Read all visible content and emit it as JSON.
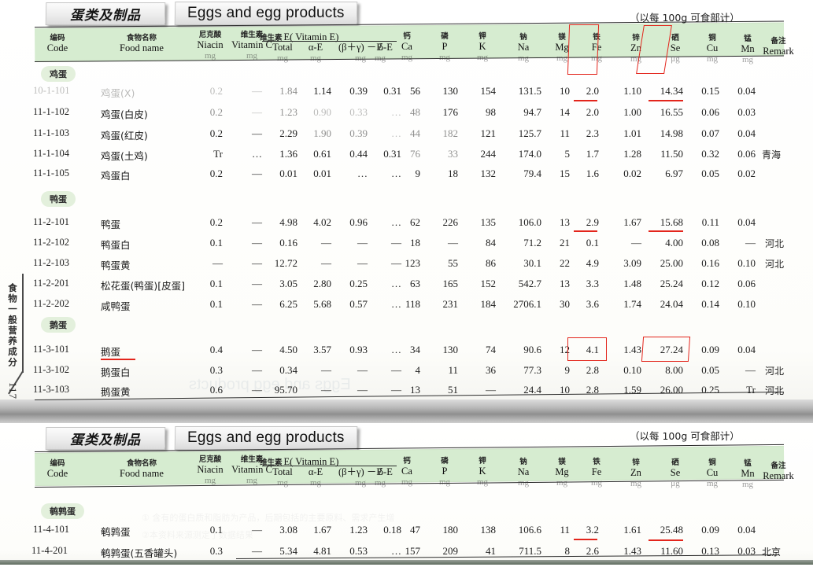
{
  "book": {
    "margin_vertical_text": "食物一般营养成分",
    "page_number": "117"
  },
  "pages": [
    {
      "id": "top",
      "title_cn": "蛋类及制品",
      "title_en": "Eggs and egg products",
      "per_100g_note": "（以每 100g 可食部计）",
      "columns": [
        {
          "cn": "编码",
          "en": "Code",
          "unit": ""
        },
        {
          "cn": "食物名称",
          "en": "Food name",
          "unit": ""
        },
        {
          "cn": "尼克酸",
          "en": "Niacin",
          "unit": "mg"
        },
        {
          "cn": "维生素",
          "en": "Vitamin C",
          "unit": "mg",
          "cn_suffix": "C"
        },
        {
          "cn": "",
          "en": "Total",
          "unit": "mg"
        },
        {
          "cn": "",
          "en": "α-E",
          "unit": "mg"
        },
        {
          "cn": "",
          "en": "(β＋γ) －E",
          "unit": "mg"
        },
        {
          "cn": "",
          "en": "δ-E",
          "unit": "mg"
        },
        {
          "cn": "钙",
          "en": "Ca",
          "unit": "mg"
        },
        {
          "cn": "磷",
          "en": "P",
          "unit": "mg"
        },
        {
          "cn": "钾",
          "en": "K",
          "unit": "mg"
        },
        {
          "cn": "钠",
          "en": "Na",
          "unit": "mg"
        },
        {
          "cn": "镁",
          "en": "Mg",
          "unit": "mg"
        },
        {
          "cn": "铁",
          "en": "Fe",
          "unit": "mg"
        },
        {
          "cn": "锌",
          "en": "Zn",
          "unit": "mg"
        },
        {
          "cn": "硒",
          "en": "Se",
          "unit": "μg"
        },
        {
          "cn": "铜",
          "en": "Cu",
          "unit": "mg"
        },
        {
          "cn": "锰",
          "en": "Mn",
          "unit": "mg"
        },
        {
          "cn": "备注",
          "en": "Remark",
          "unit": ""
        }
      ],
      "vitamin_e_group": {
        "cn": "维生素",
        "en": "E( Vitamin E)"
      },
      "sections": [
        {
          "label": "鸡蛋",
          "rows": [
            {
              "code": "10-1-101",
              "name": "鸡蛋(X)",
              "niacin": "0.2",
              "vitc": "—",
              "total": "1.84",
              "ae": "1.14",
              "bge": "0.39",
              "de": "0.31",
              "ca": "56",
              "p": "130",
              "k": "154",
              "na": "131.5",
              "mg": "10",
              "fe": "2.0",
              "zn": "1.10",
              "se": "14.34",
              "cu": "0.15",
              "mn": "0.04",
              "remark": ""
            },
            {
              "code": "11-1-102",
              "name": "鸡蛋(白皮)",
              "niacin": "0.2",
              "vitc": "—",
              "total": "1.23",
              "ae": "0.90",
              "bge": "0.33",
              "de": "…",
              "ca": "48",
              "p": "176",
              "k": "98",
              "na": "94.7",
              "mg": "14",
              "fe": "2.0",
              "zn": "1.00",
              "se": "16.55",
              "cu": "0.06",
              "mn": "0.03",
              "remark": ""
            },
            {
              "code": "11-1-103",
              "name": "鸡蛋(红皮)",
              "niacin": "0.2",
              "vitc": "—",
              "total": "2.29",
              "ae": "1.90",
              "bge": "0.39",
              "de": "…",
              "ca": "44",
              "p": "182",
              "k": "121",
              "na": "125.7",
              "mg": "11",
              "fe": "2.3",
              "zn": "1.01",
              "se": "14.98",
              "cu": "0.07",
              "mn": "0.04",
              "remark": ""
            },
            {
              "code": "11-1-104",
              "name": "鸡蛋(土鸡)",
              "niacin": "Tr",
              "vitc": "…",
              "total": "1.36",
              "ae": "0.61",
              "bge": "0.44",
              "de": "0.31",
              "ca": "76",
              "p": "33",
              "k": "244",
              "na": "174.0",
              "mg": "5",
              "fe": "1.7",
              "zn": "1.28",
              "se": "11.50",
              "cu": "0.32",
              "mn": "0.06",
              "remark": "青海"
            },
            {
              "code": "11-1-105",
              "name": "鸡蛋白",
              "niacin": "0.2",
              "vitc": "—",
              "total": "0.01",
              "ae": "0.01",
              "bge": "…",
              "de": "…",
              "ca": "9",
              "p": "18",
              "k": "132",
              "na": "79.4",
              "mg": "15",
              "fe": "1.6",
              "zn": "0.02",
              "se": "6.97",
              "cu": "0.05",
              "mn": "0.02",
              "remark": ""
            }
          ]
        },
        {
          "label": "鸭蛋",
          "rows": [
            {
              "code": "11-2-101",
              "name": "鸭蛋",
              "niacin": "0.2",
              "vitc": "—",
              "total": "4.98",
              "ae": "4.02",
              "bge": "0.96",
              "de": "…",
              "ca": "62",
              "p": "226",
              "k": "135",
              "na": "106.0",
              "mg": "13",
              "fe": "2.9",
              "zn": "1.67",
              "se": "15.68",
              "cu": "0.11",
              "mn": "0.04",
              "remark": ""
            },
            {
              "code": "11-2-102",
              "name": "鸭蛋白",
              "niacin": "0.1",
              "vitc": "—",
              "total": "0.16",
              "ae": "—",
              "bge": "—",
              "de": "—",
              "ca": "18",
              "p": "—",
              "k": "84",
              "na": "71.2",
              "mg": "21",
              "fe": "0.1",
              "zn": "—",
              "se": "4.00",
              "cu": "0.08",
              "mn": "—",
              "remark": "河北"
            },
            {
              "code": "11-2-103",
              "name": "鸭蛋黄",
              "niacin": "—",
              "vitc": "—",
              "total": "12.72",
              "ae": "—",
              "bge": "—",
              "de": "—",
              "ca": "123",
              "p": "55",
              "k": "86",
              "na": "30.1",
              "mg": "22",
              "fe": "4.9",
              "zn": "3.09",
              "se": "25.00",
              "cu": "0.16",
              "mn": "0.10",
              "remark": "河北"
            },
            {
              "code": "11-2-201",
              "name": "松花蛋(鸭蛋)[皮蛋]",
              "niacin": "0.1",
              "vitc": "—",
              "total": "3.05",
              "ae": "2.80",
              "bge": "0.25",
              "de": "…",
              "ca": "63",
              "p": "165",
              "k": "152",
              "na": "542.7",
              "mg": "13",
              "fe": "3.3",
              "zn": "1.48",
              "se": "25.24",
              "cu": "0.12",
              "mn": "0.06",
              "remark": ""
            },
            {
              "code": "11-2-202",
              "name": "咸鸭蛋",
              "niacin": "0.1",
              "vitc": "—",
              "total": "6.25",
              "ae": "5.68",
              "bge": "0.57",
              "de": "…",
              "ca": "118",
              "p": "231",
              "k": "184",
              "na": "2706.1",
              "mg": "30",
              "fe": "3.6",
              "zn": "1.74",
              "se": "24.04",
              "cu": "0.14",
              "mn": "0.10",
              "remark": ""
            }
          ]
        },
        {
          "label": "鹅蛋",
          "rows": [
            {
              "code": "11-3-101",
              "name": "鹅蛋",
              "niacin": "0.4",
              "vitc": "—",
              "total": "4.50",
              "ae": "3.57",
              "bge": "0.93",
              "de": "…",
              "ca": "34",
              "p": "130",
              "k": "74",
              "na": "90.6",
              "mg": "12",
              "fe": "4.1",
              "zn": "1.43",
              "se": "27.24",
              "cu": "0.09",
              "mn": "0.04",
              "remark": ""
            },
            {
              "code": "11-3-102",
              "name": "鹅蛋白",
              "niacin": "0.3",
              "vitc": "—",
              "total": "0.34",
              "ae": "—",
              "bge": "—",
              "de": "—",
              "ca": "4",
              "p": "11",
              "k": "36",
              "na": "77.3",
              "mg": "9",
              "fe": "2.8",
              "zn": "0.10",
              "se": "8.00",
              "cu": "0.05",
              "mn": "—",
              "remark": "河北"
            },
            {
              "code": "11-3-103",
              "name": "鹅蛋黄",
              "niacin": "0.6",
              "vitc": "—",
              "total": "95.70",
              "ae": "—",
              "bge": "—",
              "de": "—",
              "ca": "13",
              "p": "51",
              "k": "—",
              "na": "24.4",
              "mg": "10",
              "fe": "2.8",
              "zn": "1.59",
              "se": "26.00",
              "cu": "0.25",
              "mn": "Tr",
              "remark": "河北"
            }
          ]
        }
      ]
    },
    {
      "id": "bottom",
      "title_cn": "蛋类及制品",
      "title_en": "Eggs and egg products",
      "per_100g_note": "（以每 100g 可食部计）",
      "sections": [
        {
          "label": "鹌鹑蛋",
          "rows": [
            {
              "code": "11-4-101",
              "name": "鹌鹑蛋",
              "niacin": "0.1",
              "vitc": "—",
              "total": "3.08",
              "ae": "1.67",
              "bge": "1.23",
              "de": "0.18",
              "ca": "47",
              "p": "180",
              "k": "138",
              "na": "106.6",
              "mg": "11",
              "fe": "3.2",
              "zn": "1.61",
              "se": "25.48",
              "cu": "0.09",
              "mn": "0.04",
              "remark": ""
            },
            {
              "code": "11-4-201",
              "name": "鹌鹑蛋(五香罐头)",
              "niacin": "0.3",
              "vitc": "—",
              "total": "5.34",
              "ae": "4.81",
              "bge": "0.53",
              "de": "…",
              "ca": "157",
              "p": "209",
              "k": "41",
              "na": "711.5",
              "mg": "8",
              "fe": "2.6",
              "zn": "1.43",
              "se": "11.60",
              "cu": "0.13",
              "mn": "0.03",
              "remark": "北京"
            }
          ]
        }
      ]
    }
  ],
  "annotations": {
    "accent_color": "#e3251c",
    "underlined_values": [
      {
        "page": "top",
        "row": "10-1-101",
        "column": "fe",
        "value": "2.0"
      },
      {
        "page": "top",
        "row": "10-1-101",
        "column": "se",
        "value": "14.34"
      },
      {
        "page": "top",
        "row": "11-2-101",
        "column": "fe",
        "value": "2.9"
      },
      {
        "page": "top",
        "row": "11-2-101",
        "column": "se",
        "value": "15.68"
      },
      {
        "page": "top",
        "row": "11-3-101",
        "column": "name",
        "value": "鹅蛋"
      },
      {
        "page": "bottom",
        "row": "11-4-101",
        "column": "fe",
        "value": "3.2"
      },
      {
        "page": "bottom",
        "row": "11-4-101",
        "column": "se",
        "value": "25.48"
      }
    ],
    "boxed_values": [
      {
        "page": "top",
        "target": "header-fe",
        "value": "Fe"
      },
      {
        "page": "top",
        "target": "header-se",
        "value": "Se"
      },
      {
        "page": "top",
        "row": "11-3-101",
        "column": "fe",
        "value": "4.1"
      },
      {
        "page": "top",
        "row": "11-3-101",
        "column": "se",
        "value": "27.24"
      }
    ]
  }
}
